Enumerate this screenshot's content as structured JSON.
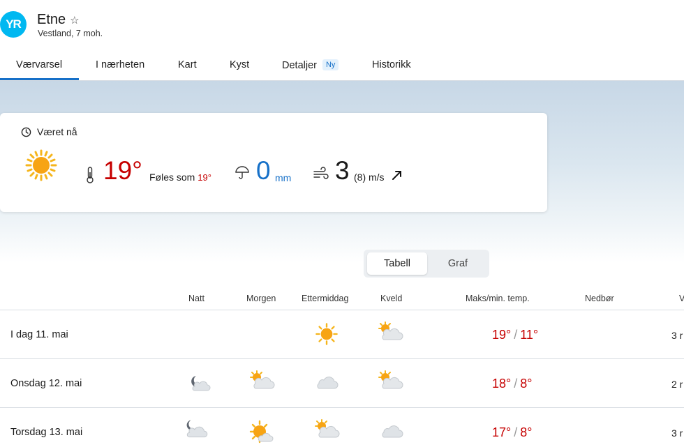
{
  "header": {
    "logo": "YR",
    "location": "Etne",
    "favorite_icon": "☆",
    "subtitle": "Vestland, 7 moh."
  },
  "tabs": [
    {
      "label": "Værvarsel",
      "active": true
    },
    {
      "label": "I nærheten"
    },
    {
      "label": "Kart"
    },
    {
      "label": "Kyst"
    },
    {
      "label": "Detaljer",
      "badge": "Ny"
    },
    {
      "label": "Historikk"
    }
  ],
  "now": {
    "title": "Været nå",
    "symbol": "clear-sky-day",
    "temperature": "19°",
    "feels_label": "Føles som",
    "feels_value": "19°",
    "precipitation": "0",
    "precip_unit": "mm",
    "wind": "3",
    "wind_gust_unit": "(8) m/s",
    "wind_direction": "north-east"
  },
  "toggle": {
    "table": "Tabell",
    "graph": "Graf"
  },
  "table": {
    "headers": {
      "night": "Natt",
      "morning": "Morgen",
      "afternoon": "Ettermiddag",
      "evening": "Kveld",
      "temp": "Maks/min. temp.",
      "precip": "Nedbør",
      "wind": "V"
    },
    "rows": [
      {
        "day": "I dag 11. mai",
        "night": "",
        "morning": "",
        "afternoon": "clear-sky",
        "evening": "partly-cloudy",
        "max": "19°",
        "min": "11°",
        "wind": "3 r"
      },
      {
        "day": "Onsdag 12. mai",
        "night": "cloudy-night",
        "morning": "partly-cloudy",
        "afternoon": "cloudy",
        "evening": "partly-cloudy",
        "max": "18°",
        "min": "8°",
        "wind": "2 r"
      },
      {
        "day": "Torsdag 13. mai",
        "night": "cloudy-night",
        "morning": "fair",
        "afternoon": "partly-cloudy",
        "evening": "cloudy",
        "max": "17°",
        "min": "8°",
        "wind": "3 r"
      }
    ]
  },
  "colors": {
    "brand": "#00b8f1",
    "accent": "#1670c8",
    "warm_temp": "#c60000"
  }
}
